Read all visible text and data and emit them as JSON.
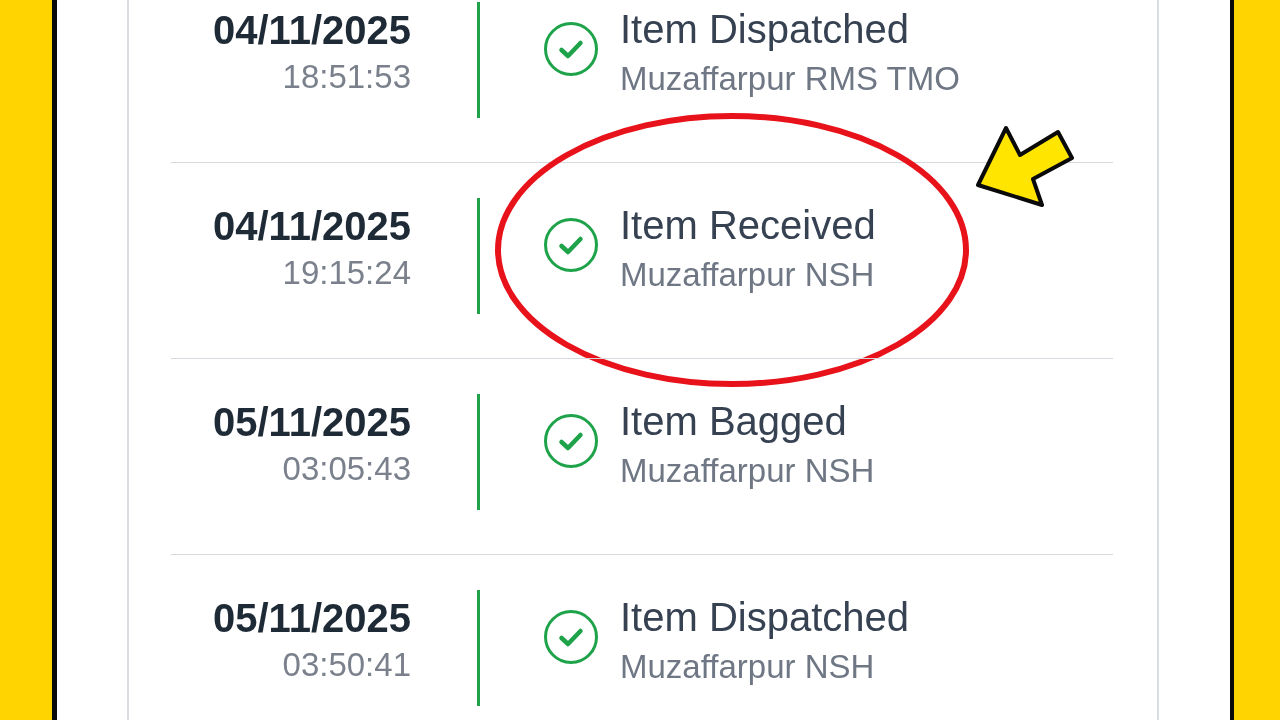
{
  "events": [
    {
      "date": "04/11/2025",
      "time": "18:51:53",
      "status": "Item Dispatched",
      "location": "Muzaffarpur RMS TMO",
      "circled": false
    },
    {
      "date": "04/11/2025",
      "time": "19:15:24",
      "status": "Item Received",
      "location": "Muzaffarpur NSH",
      "circled": true
    },
    {
      "date": "05/11/2025",
      "time": "03:05:43",
      "status": "Item Bagged",
      "location": "Muzaffarpur NSH",
      "circled": false
    },
    {
      "date": "05/11/2025",
      "time": "03:50:41",
      "status": "Item Dispatched",
      "location": "Muzaffarpur NSH",
      "circled": false
    }
  ]
}
